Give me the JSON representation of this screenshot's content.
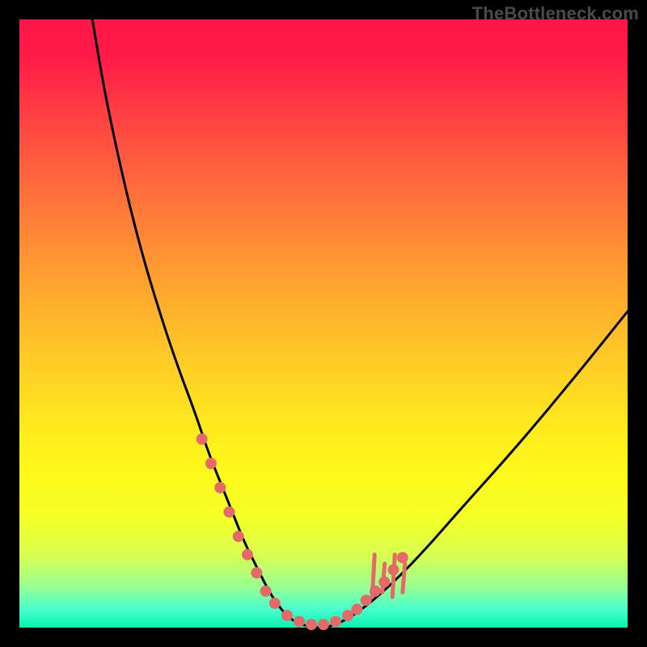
{
  "watermark": "TheBottleneck.com",
  "chart_data": {
    "type": "line",
    "title": "",
    "xlabel": "",
    "ylabel": "",
    "xlim": [
      0,
      100
    ],
    "ylim": [
      0,
      100
    ],
    "series": [
      {
        "name": "curve",
        "x": [
          12,
          14,
          17,
          20,
          23,
          26,
          29,
          31,
          33,
          35,
          37,
          39,
          41,
          43,
          45,
          48,
          51,
          55,
          60,
          66,
          73,
          82,
          92,
          100
        ],
        "values": [
          100,
          88,
          74,
          62,
          52,
          43,
          35,
          29,
          24,
          19,
          14,
          10,
          6,
          3,
          1,
          0,
          0,
          2,
          6,
          12,
          20,
          30,
          42,
          52
        ]
      }
    ],
    "markers": {
      "name": "dots",
      "color": "#e46a6a",
      "points": [
        {
          "x": 30,
          "y": 31
        },
        {
          "x": 31.5,
          "y": 27
        },
        {
          "x": 33,
          "y": 23
        },
        {
          "x": 34.5,
          "y": 19
        },
        {
          "x": 36,
          "y": 15
        },
        {
          "x": 37.5,
          "y": 12
        },
        {
          "x": 39,
          "y": 9
        },
        {
          "x": 40.5,
          "y": 6
        },
        {
          "x": 42,
          "y": 4
        },
        {
          "x": 44,
          "y": 2
        },
        {
          "x": 46,
          "y": 1
        },
        {
          "x": 48,
          "y": 0.5
        },
        {
          "x": 50,
          "y": 0.5
        },
        {
          "x": 52,
          "y": 1
        },
        {
          "x": 54,
          "y": 2
        },
        {
          "x": 55.5,
          "y": 3
        },
        {
          "x": 57,
          "y": 4.5
        },
        {
          "x": 58.5,
          "y": 6
        },
        {
          "x": 60,
          "y": 7.5
        },
        {
          "x": 61.5,
          "y": 9.5
        },
        {
          "x": 63,
          "y": 11.5
        }
      ]
    },
    "flames": {
      "name": "flames",
      "color": "#e46a6a",
      "x_range": [
        58,
        63
      ],
      "y_range": [
        5,
        12
      ]
    }
  }
}
